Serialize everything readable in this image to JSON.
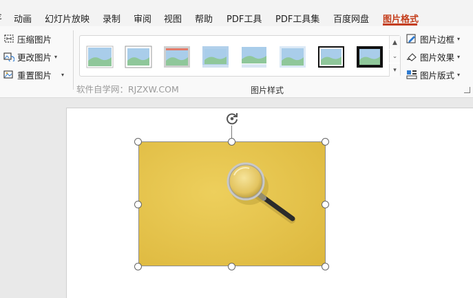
{
  "tabs": [
    {
      "label": "动画",
      "active": false
    },
    {
      "label": "幻灯片放映",
      "active": false
    },
    {
      "label": "录制",
      "active": false
    },
    {
      "label": "审阅",
      "active": false
    },
    {
      "label": "视图",
      "active": false
    },
    {
      "label": "帮助",
      "active": false
    },
    {
      "label": "PDF工具",
      "active": false
    },
    {
      "label": "PDF工具集",
      "active": false
    },
    {
      "label": "百度网盘",
      "active": false
    },
    {
      "label": "图片格式",
      "active": true
    }
  ],
  "adjust_group": {
    "compress": "压缩图片",
    "change": "更改图片",
    "reset": "重置图片"
  },
  "styles_group": {
    "label": "图片样式",
    "watermark": "软件自学网：RJZXW.COM",
    "thumb_count": 8
  },
  "right_group": {
    "border": "图片边框",
    "effects": "图片效果",
    "layout": "图片版式"
  },
  "colors": {
    "accent": "#c43e1c",
    "picture_bg": "#e8c64f",
    "thumb_blue": "#7fb1dd",
    "thumb_green": "#8fc79a"
  },
  "icons": {
    "rotate": "rotate-icon",
    "magnifier": "magnifying-glass"
  }
}
